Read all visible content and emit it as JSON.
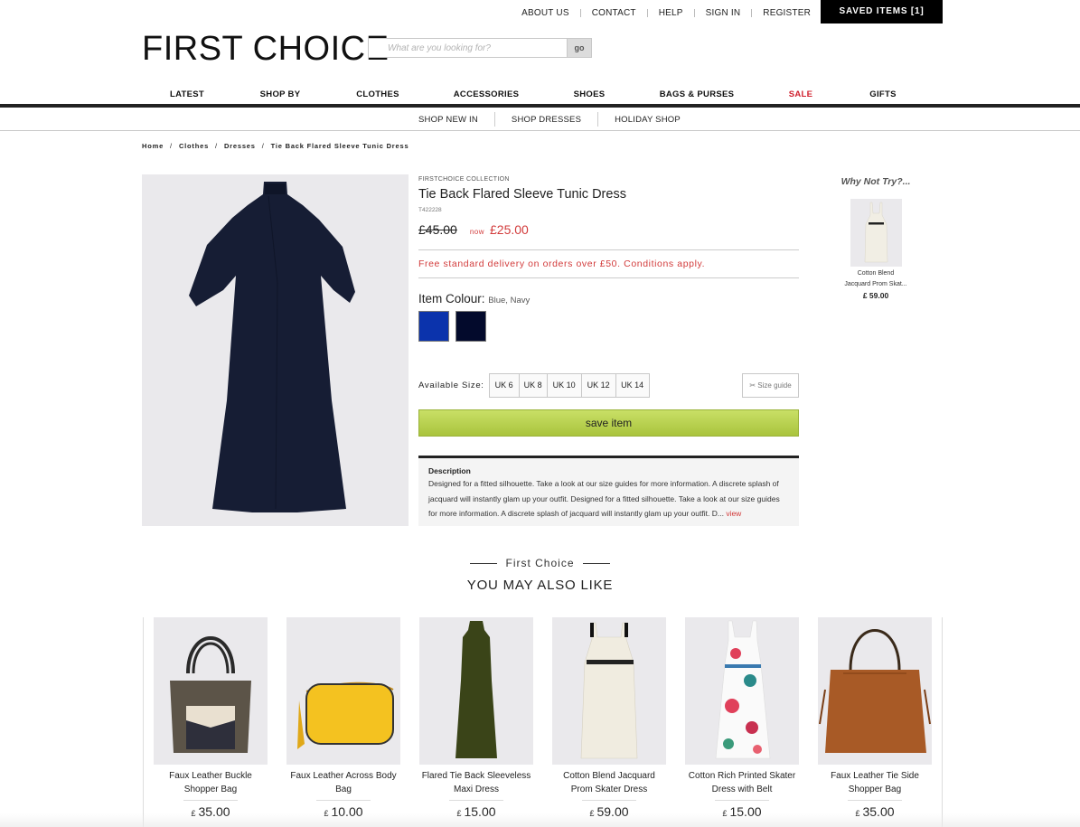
{
  "utility_nav": {
    "links": [
      "ABOUT US",
      "CONTACT",
      "HELP",
      "SIGN IN",
      "REGISTER"
    ],
    "saved_items": "SAVED ITEMS [1]"
  },
  "header": {
    "logo": "FIRST CHOICE",
    "search_placeholder": "What are you looking for?",
    "search_button": "go"
  },
  "main_nav": [
    "LATEST",
    "SHOP BY",
    "CLOTHES",
    "ACCESSORIES",
    "SHOES",
    "BAGS & PURSES",
    "SALE",
    "GIFTS"
  ],
  "sub_nav": [
    "SHOP NEW IN",
    "SHOP DRESSES",
    "HOLIDAY SHOP"
  ],
  "breadcrumb": [
    "Home",
    "Clothes",
    "Dresses",
    "Tie Back Flared Sleeve Tunic Dress"
  ],
  "product": {
    "brand": "FIRSTCHOICE COLLECTION",
    "title": "Tie Back Flared Sleeve Tunic Dress",
    "sku": "T422228",
    "was_price": "£45.00",
    "now_label": "now",
    "now_price": "£25.00",
    "delivery": "Free standard delivery on orders over £50. Conditions apply.",
    "colour_label": "Item Colour:",
    "colour_value": "Blue, Navy",
    "swatches": [
      "#0b33ac",
      "#030a2c"
    ],
    "size_label": "Available Size:",
    "sizes": [
      "UK 6",
      "UK 8",
      "UK 10",
      "UK 12",
      "UK 14"
    ],
    "size_guide": "Size guide",
    "save_button": "save item",
    "description_title": "Description",
    "description": "Designed for a fitted silhouette. Take a look at our size guides for more information. A discrete splash of jacquard will instantly glam up your outfit. Designed for a fitted silhouette. Take a look at our size guides for more information. A discrete splash of jacquard will instantly glam up your outfit. D...",
    "description_more": "view"
  },
  "why_not_try": {
    "heading": "Why Not Try?...",
    "name_line1": "Cotton Blend",
    "name_line2": "Jacquard Prom Skat...",
    "price": "£ 59.00"
  },
  "also_like": {
    "kicker": "First Choice",
    "heading": "YOU MAY ALSO LIKE",
    "currency": "£",
    "items": [
      {
        "name": "Faux Leather Buckle Shopper Bag",
        "price": "35.00"
      },
      {
        "name": "Faux Leather Across Body Bag",
        "price": "10.00"
      },
      {
        "name": "Flared Tie Back Sleeveless Maxi Dress",
        "price": "15.00"
      },
      {
        "name": "Cotton Blend Jacquard Prom Skater Dress",
        "price": "59.00"
      },
      {
        "name": "Cotton Rich Printed Skater Dress with Belt",
        "price": "15.00"
      },
      {
        "name": "Faux Leather Tie Side Shopper Bag",
        "price": "35.00"
      }
    ]
  },
  "colors": {
    "sale_red": "#d0202e",
    "price_red": "#d23b3b",
    "save_green": "#b5cf4a",
    "saved_bar": "#000000"
  }
}
